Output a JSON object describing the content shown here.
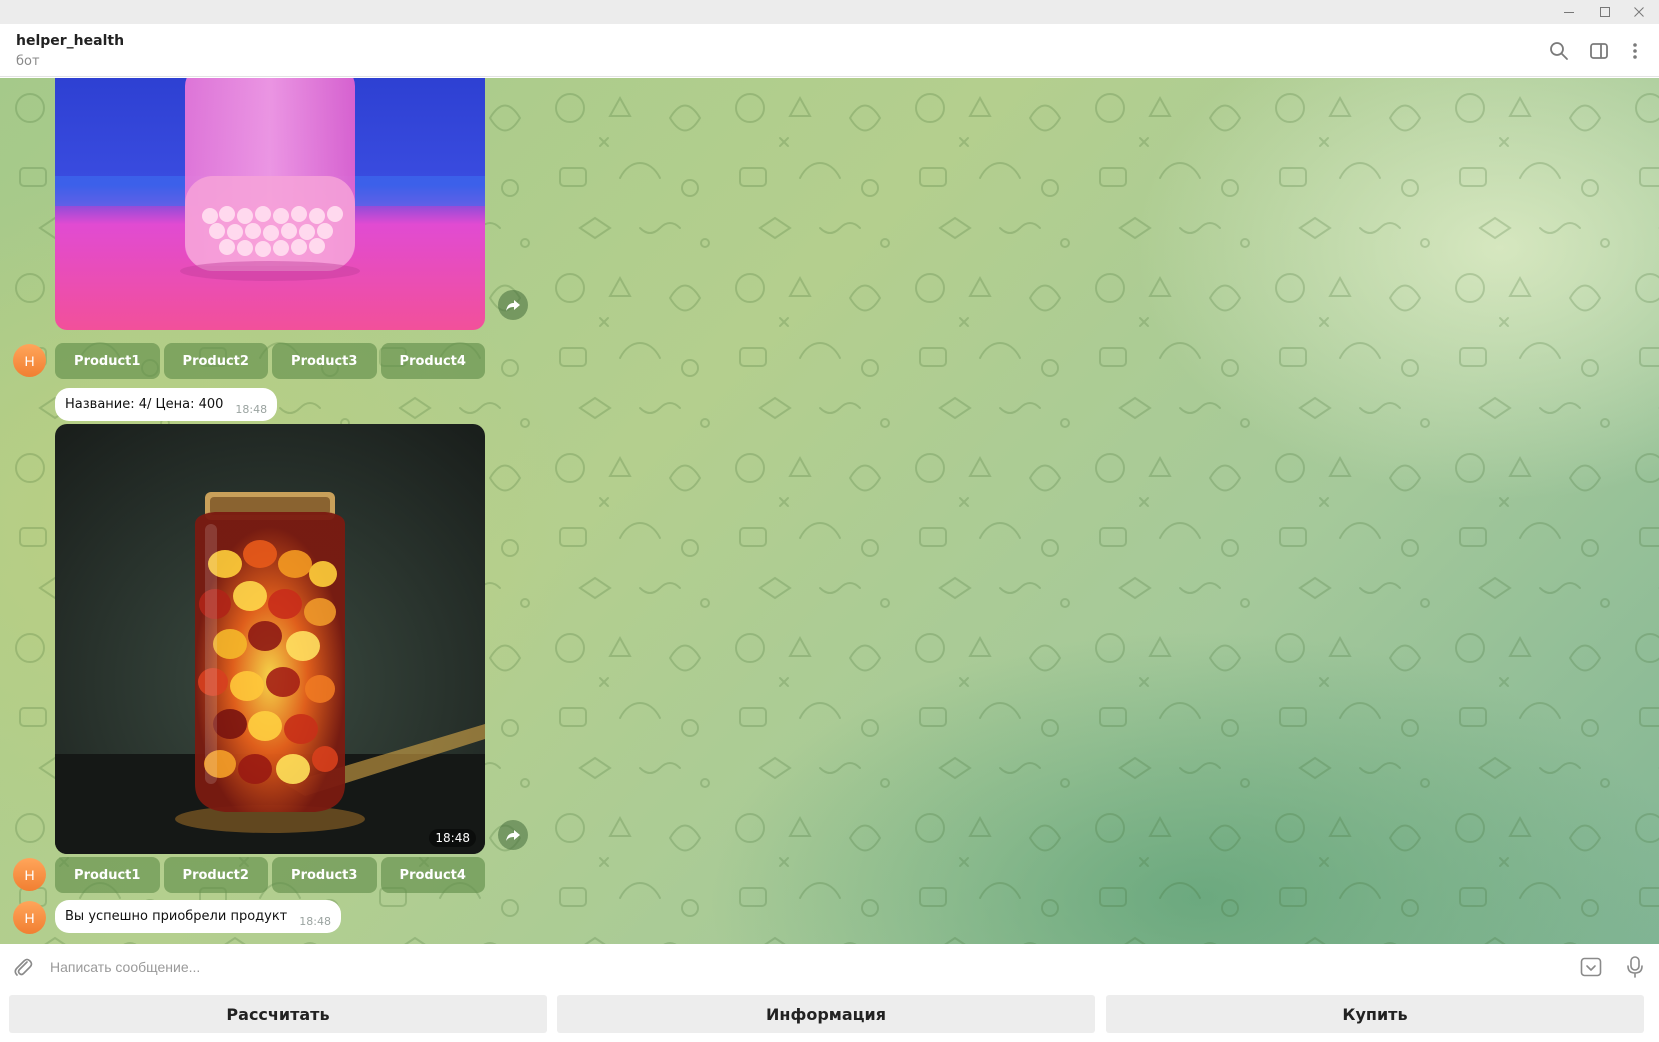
{
  "window": {
    "buttons": [
      "minimize",
      "maximize",
      "close"
    ]
  },
  "header": {
    "title": "helper_health",
    "status": "бот",
    "icons": [
      "search-icon",
      "sidebar-toggle-icon",
      "more-vertical-icon"
    ]
  },
  "chat": {
    "avatar_letter": "H",
    "photo1": {
      "description_icon": "pink-pill-bottle-photo"
    },
    "keyboard1": [
      "Product1",
      "Product2",
      "Product3",
      "Product4"
    ],
    "message1": {
      "text": "Название: 4/ Цена: 400",
      "time": "18:48"
    },
    "photo2": {
      "time": "18:48",
      "description_icon": "amber-capsule-jar-photo"
    },
    "keyboard2": [
      "Product1",
      "Product2",
      "Product3",
      "Product4"
    ],
    "message2": {
      "text": "Вы успешно приобрели продукт",
      "time": "18:48"
    }
  },
  "composer": {
    "placeholder": "Написать сообщение...",
    "icons": [
      "attach-icon",
      "bot-keyboard-icon",
      "microphone-icon"
    ]
  },
  "reply_keyboard": [
    "Рассчитать",
    "Информация",
    "Купить"
  ],
  "colors": {
    "accent": "#f17f32",
    "keyboard_button": "#5f8c48",
    "chat_background": "#a5c98a"
  }
}
